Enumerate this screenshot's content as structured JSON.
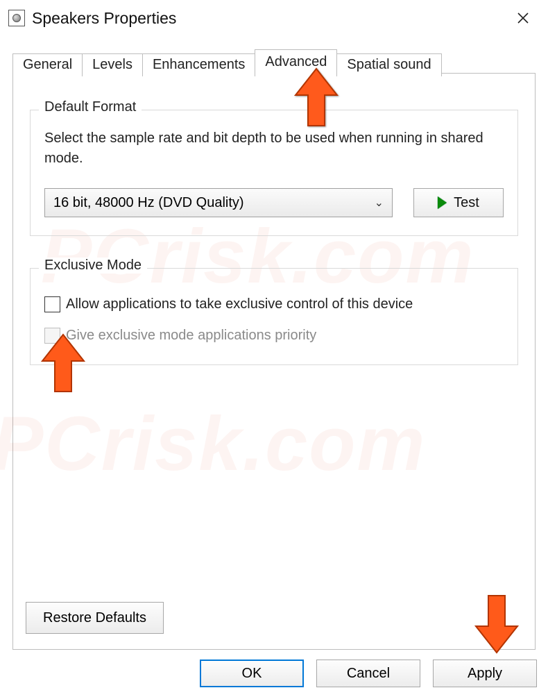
{
  "window": {
    "title": "Speakers Properties"
  },
  "tabs": {
    "general": "General",
    "levels": "Levels",
    "enhancements": "Enhancements",
    "advanced": "Advanced",
    "spatial": "Spatial sound",
    "active": "Advanced"
  },
  "default_format": {
    "legend": "Default Format",
    "description": "Select the sample rate and bit depth to be used when running in shared mode.",
    "selected": "16 bit, 48000 Hz (DVD Quality)",
    "test_label": "Test"
  },
  "exclusive_mode": {
    "legend": "Exclusive Mode",
    "allow_label": "Allow applications to take exclusive control of this device",
    "allow_checked": false,
    "priority_label": "Give exclusive mode applications priority",
    "priority_enabled": false
  },
  "restore_defaults_label": "Restore Defaults",
  "footer": {
    "ok": "OK",
    "cancel": "Cancel",
    "apply": "Apply"
  },
  "watermark": "PCrisk.com"
}
